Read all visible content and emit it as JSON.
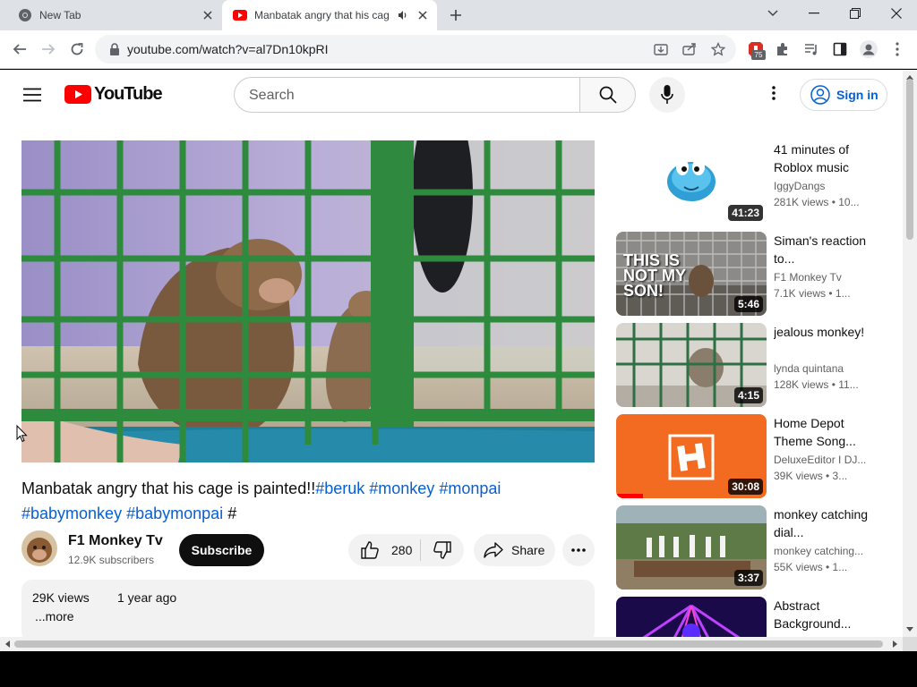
{
  "browser": {
    "tabs": [
      {
        "title": "New Tab"
      },
      {
        "title": "Manbatak angry that his cag",
        "active": true
      }
    ],
    "url": "youtube.com/watch?v=al7Dn10kpRI",
    "extension_badge": "75"
  },
  "youtube": {
    "logo_text": "YouTube",
    "search_placeholder": "Search",
    "sign_in_label": "Sign in"
  },
  "video": {
    "title_text": "Manbatak angry that his cage is painted!!",
    "hashtags_line1": [
      "#beruk",
      "#monkey",
      "#monpai"
    ],
    "hashtags_line2": [
      "#babymonkey",
      "#babymonpai"
    ],
    "trailing": "#",
    "channel_name": "F1 Monkey Tv",
    "subscribers": "12.9K subscribers",
    "subscribe_label": "Subscribe",
    "likes": "280",
    "share_label": "Share",
    "views": "29K views",
    "date": "1 year ago",
    "more_label": "...more"
  },
  "recommendations": [
    {
      "title": "41 minutes of Roblox music",
      "channel": "IggyDangs",
      "meta": "281K views • 10...",
      "duration": "41:23"
    },
    {
      "title": "Siman's reaction to...",
      "channel": "F1 Monkey Tv",
      "meta": "7.1K views • 1...",
      "duration": "5:46",
      "thumb_text": "THIS IS NOT MY SON!"
    },
    {
      "title": "jealous monkey!",
      "channel": "lynda quintana",
      "meta": "128K views • 11...",
      "duration": "4:15"
    },
    {
      "title": "Home Depot Theme Song...",
      "channel": "DeluxeEditor I DJ...",
      "meta": "39K views • 3...",
      "duration": "30:08"
    },
    {
      "title": "monkey catching dial...",
      "channel": "monkey catching...",
      "meta": "55K views • 1...",
      "duration": "3:37"
    },
    {
      "title": "Abstract Background...",
      "channel": "",
      "meta": "",
      "duration": ""
    }
  ],
  "colors": {
    "yt_red": "#ff0000",
    "link_blue": "#065fd4",
    "subscribe_bg": "#0f0f0f",
    "chrome_tabstrip": "#dee1e6"
  }
}
